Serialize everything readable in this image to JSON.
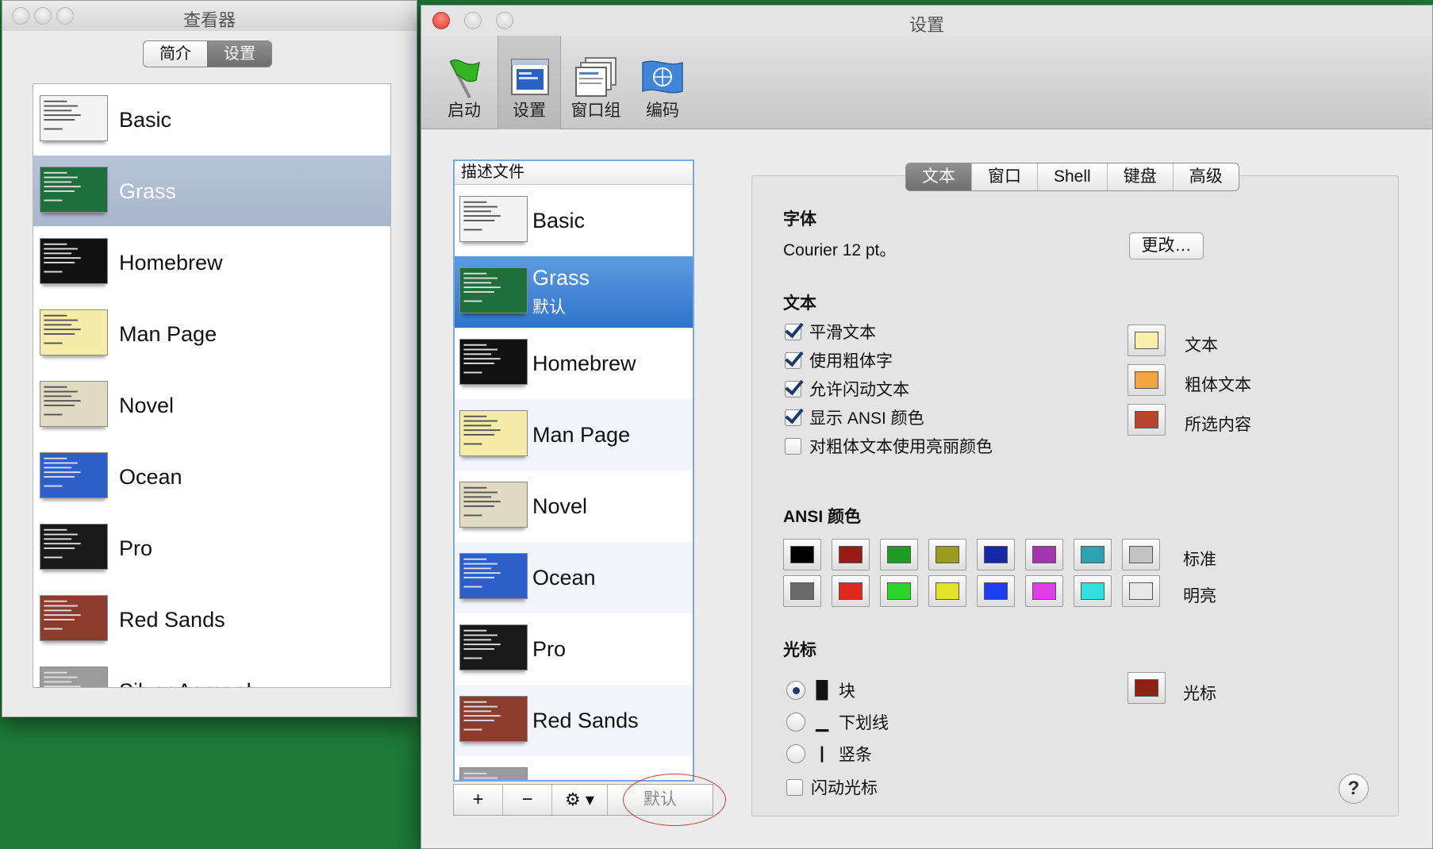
{
  "viewer": {
    "title": "查看器",
    "tabs": [
      "简介",
      "设置"
    ],
    "selected_tab": 1,
    "profiles": [
      {
        "label": "Basic",
        "color": "#f4f4f4"
      },
      {
        "label": "Grass",
        "color": "#1e6f3c",
        "selected": true
      },
      {
        "label": "Homebrew",
        "color": "#111111"
      },
      {
        "label": "Man Page",
        "color": "#f6ecaa"
      },
      {
        "label": "Novel",
        "color": "#e2dbc3"
      },
      {
        "label": "Ocean",
        "color": "#2c5fc9"
      },
      {
        "label": "Pro",
        "color": "#1a1a1a"
      },
      {
        "label": "Red Sands",
        "color": "#8c3b2c"
      },
      {
        "label": "Silver Aerogel",
        "color": "#9b9b9b"
      }
    ]
  },
  "prefs": {
    "title": "设置",
    "toolbar": [
      {
        "label": "启动",
        "icon": "flag-icon"
      },
      {
        "label": "设置",
        "icon": "settings-profiles-icon",
        "active": true
      },
      {
        "label": "窗口组",
        "icon": "window-groups-icon"
      },
      {
        "label": "编码",
        "icon": "encoding-globe-icon"
      }
    ],
    "profile_list": {
      "header": "描述文件",
      "items": [
        {
          "label": "Basic",
          "color": "#f4f4f4"
        },
        {
          "label": "Grass",
          "sub": "默认",
          "color": "#1e6f3c",
          "selected": true
        },
        {
          "label": "Homebrew",
          "color": "#111111"
        },
        {
          "label": "Man Page",
          "color": "#f6ecaa"
        },
        {
          "label": "Novel",
          "color": "#e2dbc3"
        },
        {
          "label": "Ocean",
          "color": "#2c5fc9"
        },
        {
          "label": "Pro",
          "color": "#1a1a1a"
        },
        {
          "label": "Red Sands",
          "color": "#8c3b2c"
        },
        {
          "label": "",
          "color": "#9b9b9b"
        }
      ],
      "add_label": "+",
      "remove_label": "−",
      "gear_label": "⚙ ▾",
      "default_label": "默认"
    },
    "tabs": [
      "文本",
      "窗口",
      "Shell",
      "键盘",
      "高级"
    ],
    "active_tab": 0,
    "font": {
      "heading": "字体",
      "value": "Courier 12 pt。",
      "change_label": "更改…"
    },
    "text": {
      "heading": "文本",
      "options": [
        {
          "label": "平滑文本",
          "checked": true
        },
        {
          "label": "使用粗体字",
          "checked": true
        },
        {
          "label": "允许闪动文本",
          "checked": true
        },
        {
          "label": "显示 ANSI 颜色",
          "checked": true
        },
        {
          "label": "对粗体文本使用亮丽颜色",
          "checked": false
        }
      ],
      "colors": [
        {
          "label": "文本",
          "color": "#faf0a8"
        },
        {
          "label": "粗体文本",
          "color": "#f3a63f"
        },
        {
          "label": "所选内容",
          "color": "#b6452c"
        }
      ]
    },
    "ansi": {
      "heading": "ANSI 颜色",
      "normal_label": "标准",
      "bright_label": "明亮",
      "normal": [
        "#000000",
        "#9b1b16",
        "#1f9c22",
        "#9c9a1f",
        "#1729a8",
        "#a833b2",
        "#2aa3b3",
        "#c2c2c2"
      ],
      "bright": [
        "#6a6a6a",
        "#e02820",
        "#2cd42c",
        "#e3e32a",
        "#1b3ff0",
        "#e13ce6",
        "#33e0e0",
        "#e8e8e8"
      ]
    },
    "cursor": {
      "heading": "光标",
      "options": [
        {
          "label": "块",
          "glyph": "█",
          "selected": true
        },
        {
          "label": "下划线",
          "glyph": "▁",
          "selected": false
        },
        {
          "label": "竖条",
          "glyph": "|",
          "selected": false
        }
      ],
      "blink_label": "闪动光标",
      "blink_checked": false,
      "color_label": "光标",
      "color": "#8d2413"
    },
    "help_label": "?"
  }
}
